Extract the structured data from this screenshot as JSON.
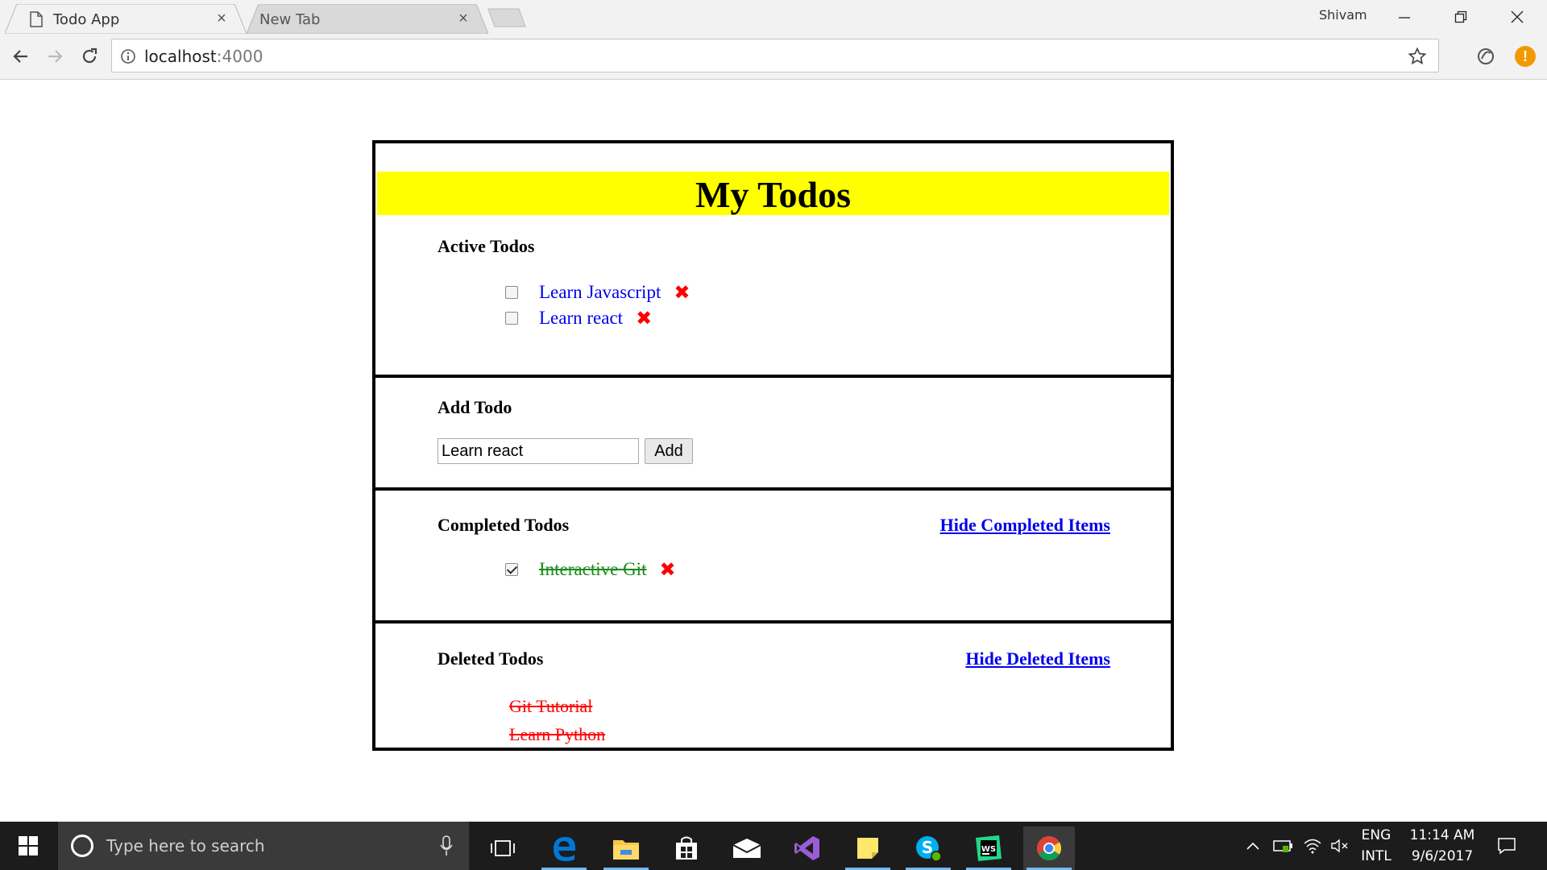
{
  "browser": {
    "tabs": [
      {
        "label": "Todo App",
        "active": true
      },
      {
        "label": "New Tab",
        "active": false
      }
    ],
    "profile_name": "Shivam",
    "url_host": "localhost",
    "url_port": ":4000"
  },
  "app": {
    "title": "My Todos",
    "active": {
      "heading": "Active Todos",
      "items": [
        {
          "text": "Learn Javascript",
          "checked": false
        },
        {
          "text": "Learn react",
          "checked": false
        }
      ]
    },
    "add": {
      "heading": "Add Todo",
      "input_value": "Learn react",
      "button_label": "Add"
    },
    "completed": {
      "heading": "Completed Todos",
      "toggle_label": "Hide Completed Items",
      "items": [
        {
          "text": "Interactive Git",
          "checked": true
        }
      ]
    },
    "deleted": {
      "heading": "Deleted Todos",
      "toggle_label": "Hide Deleted Items",
      "items": [
        {
          "text": "Git Tutorial"
        },
        {
          "text": "Learn Python"
        }
      ]
    },
    "delete_glyph": "✖"
  },
  "taskbar": {
    "search_placeholder": "Type here to search",
    "lang_top": "ENG",
    "lang_bottom": "INTL",
    "time": "11:14 AM",
    "date": "9/6/2017"
  },
  "colors": {
    "header_bg": "#ffff00",
    "link": "#0000ee",
    "completed_text": "#1a8a1a",
    "delete_red": "#ff0000"
  }
}
